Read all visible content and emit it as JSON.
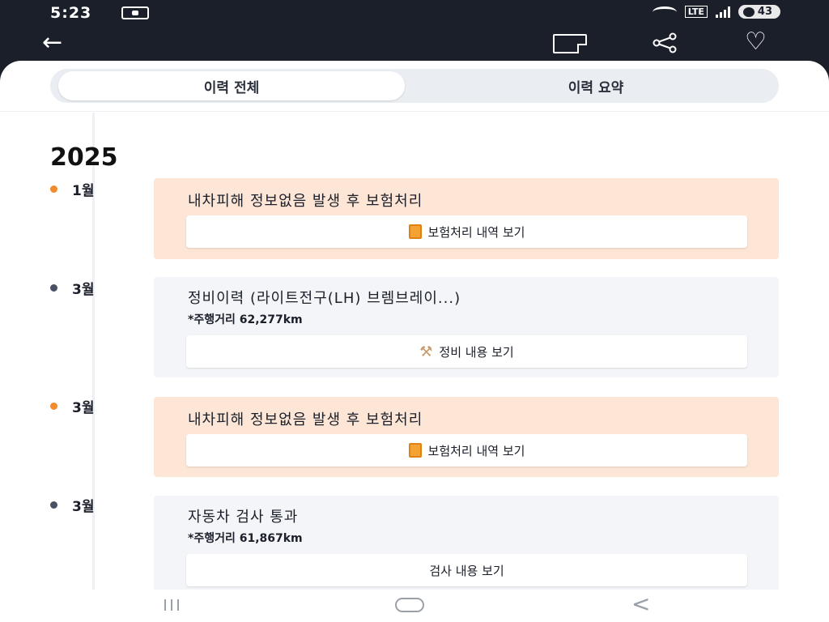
{
  "status": {
    "time": "5:23",
    "lte": "LTE",
    "battery": "43"
  },
  "tabs": [
    {
      "label": "이력 전체",
      "selected": true
    },
    {
      "label": "이력 요약",
      "selected": false
    }
  ],
  "year": "2025",
  "entries": [
    {
      "month": "1월",
      "dot_color": "#f28a2e",
      "card_color": "#fde6d6",
      "title": "내차피해 정보없음 발생 후 보험처리",
      "button_label": "보험처리 내역 보기"
    },
    {
      "month": "3월",
      "dot_color": "#4a5063",
      "card_color": "#f3f5f8",
      "title": "정비이력 (라이트전구(LH) 브렘브레이...)",
      "mileage": "*주행거리 62,277km",
      "button_label": "정비 내용 보기"
    },
    {
      "month": "3월",
      "dot_color": "#f28a2e",
      "card_color": "#fde6d6",
      "title": "내차피해 정보없음 발생 후 보험처리",
      "button_label": "보험처리 내역 보기"
    },
    {
      "month": "3월",
      "dot_color": "#4a5063",
      "card_color": "#f3f5f8",
      "title": "자동차 검사 통과",
      "mileage": "*주행거리 61,867km",
      "button_label": "검사 내용 보기"
    }
  ],
  "icons": {
    "back": "arrow-left",
    "memo": "memo",
    "share": "share",
    "heart": "heart-outline"
  }
}
